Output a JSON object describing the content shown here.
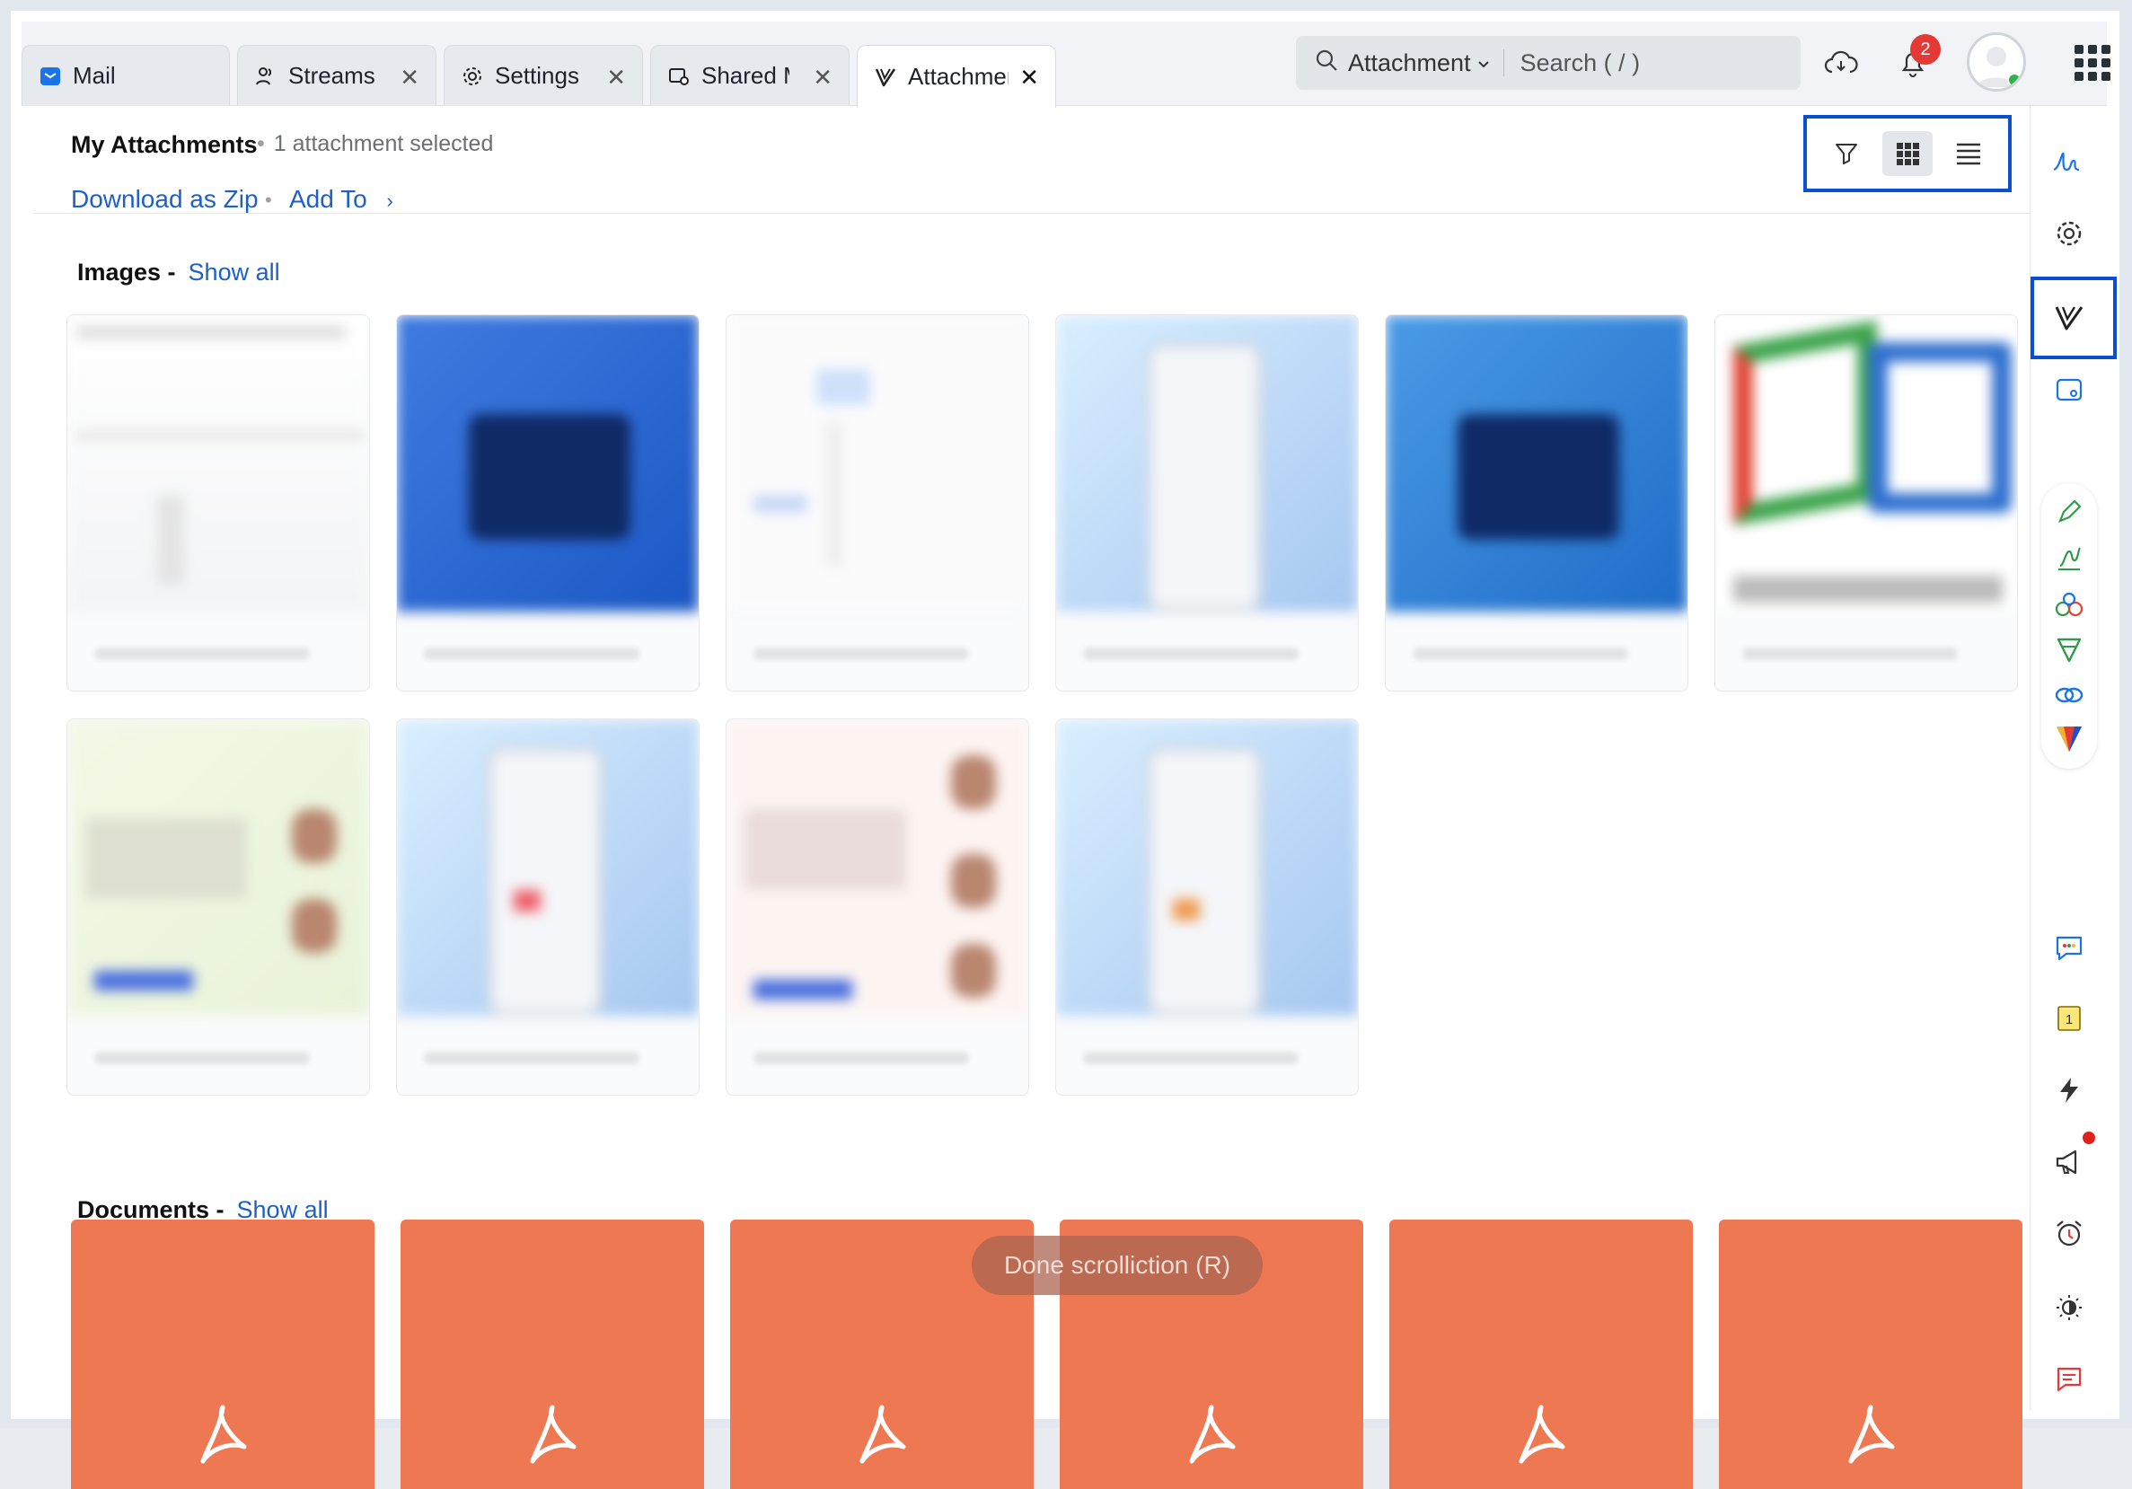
{
  "tabs": [
    {
      "label": "Mail",
      "icon": "mail-icon"
    },
    {
      "label": "Streams",
      "icon": "streams-icon"
    },
    {
      "label": "Settings",
      "icon": "gear-icon"
    },
    {
      "label": "Shared M",
      "icon": "shared-icon"
    },
    {
      "label": "Attachmer",
      "icon": "attachment-icon"
    }
  ],
  "search": {
    "scope": "Attachment",
    "placeholder": "Search ( / )"
  },
  "notifications": {
    "count": "2"
  },
  "header": {
    "title": "My Attachments",
    "selection": "1 attachment selected",
    "download_label": "Download as Zip",
    "add_to_label": "Add To"
  },
  "view": {
    "active": "grid"
  },
  "images_section": {
    "title": "Images -",
    "show_all": "Show all"
  },
  "documents_section": {
    "title": "Documents -",
    "show_all": "Show all"
  },
  "toast": {
    "text": "Done scrolliction (R)"
  },
  "image_card_count": 10,
  "document_card_count": 6,
  "rail_icons": [
    "signature-icon",
    "gear-icon",
    "attachment-icon",
    "calendar-icon",
    "pen-icon",
    "sign-icon",
    "bookings-icon",
    "forms-icon",
    "link-icon",
    "vani-icon",
    "chat-icon",
    "notes-icon",
    "flash-icon",
    "announcement-icon",
    "alarm-icon",
    "theme-icon",
    "feedback-icon"
  ],
  "notes_count": "1",
  "colors": {
    "accent": "#0a4fcf",
    "link": "#1f5fc8",
    "pdf": "#ee7852",
    "badge": "#e53935"
  }
}
